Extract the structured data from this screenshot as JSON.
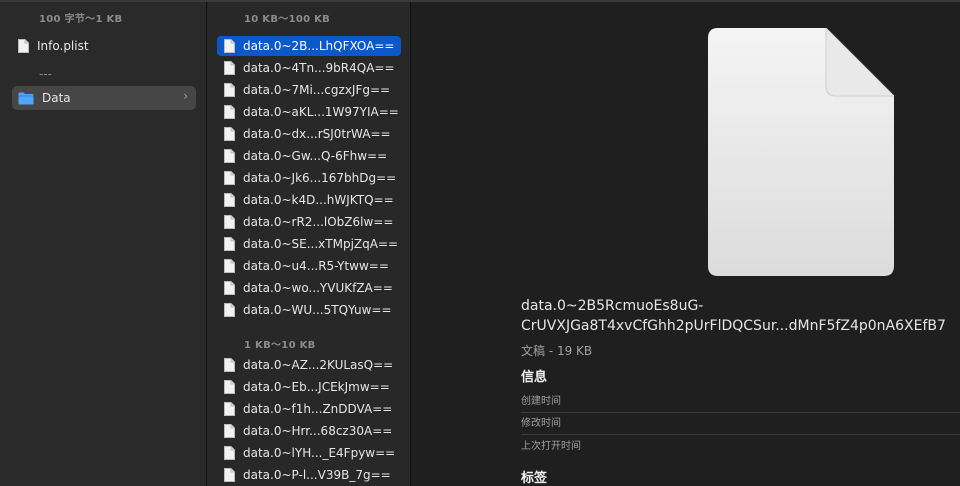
{
  "sidebar": {
    "header": "100 字节～1 KB",
    "items": [
      {
        "label": "Info.plist",
        "type": "file"
      },
      {
        "label": "---",
        "type": "separator"
      },
      {
        "label": "Data",
        "type": "folder",
        "selected": true
      }
    ]
  },
  "list": {
    "section1": {
      "header": "10 KB～100 KB",
      "items": [
        "data.0~2B...LhQFXOA==",
        "data.0~4Tn...9bR4QA==",
        "data.0~7Mi...cgzxJFg==",
        "data.0~aKL...1W97YIA==",
        "data.0~dx...rSJ0trWA==",
        "data.0~Gw...Q-6Fhw==",
        "data.0~Jk6...167bhDg==",
        "data.0~k4D...hWJKTQ==",
        "data.0~rR2...lObZ6lw==",
        "data.0~SE...xTMpjZqA==",
        "data.0~u4...R5-Ytww==",
        "data.0~wo...YVUKfZA==",
        "data.0~WU...5TQYuw=="
      ],
      "selected_index": 0
    },
    "section2": {
      "header": "1 KB～10 KB",
      "items": [
        "data.0~AZ...2KULasQ==",
        "data.0~Eb...JCEkJmw==",
        "data.0~f1h...ZnDDVA==",
        "data.0~Hrr...68cz30A==",
        "data.0~lYH..._E4Fpyw==",
        "data.0~P-l...V39B_7g=="
      ]
    }
  },
  "preview": {
    "filename_line1": "data.0~2B5RcmuoEs8uG-",
    "filename_line2": "CrUVXJGa8T4xvCfGhh2pUrFlDQCSur...dMnF5fZ4p0nA6XEfB7",
    "kind_size": "文稿 - 19 KB",
    "info_title": "信息",
    "info_rows": [
      "创建时间",
      "修改时间",
      "上次打开时间"
    ],
    "tags_title": "标签"
  },
  "colors": {
    "selection": "#0a58ca",
    "background": "#1e1e1e",
    "folder": "#4fa6ff"
  },
  "icons": {
    "file": "document-icon",
    "folder": "folder-icon",
    "chevron": "chevron-right-icon"
  }
}
